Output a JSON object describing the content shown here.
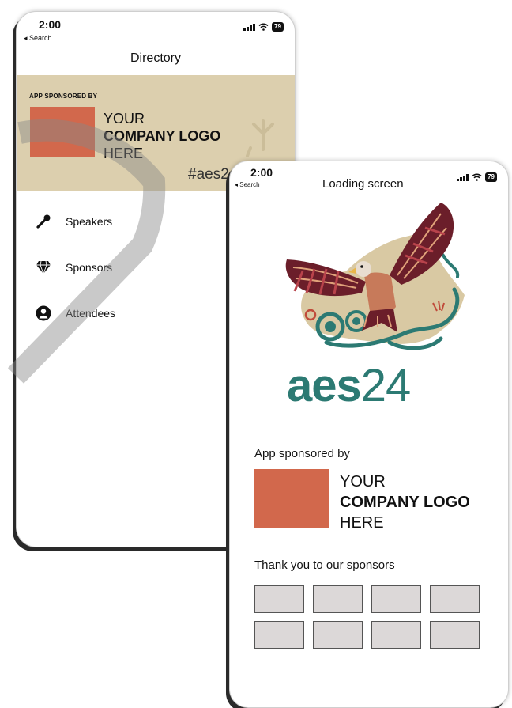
{
  "directory_screen": {
    "status": {
      "time": "2:00",
      "back": "◂ Search",
      "battery": "79"
    },
    "title": "Directory",
    "banner": {
      "sponsored_label": "APP SPONSORED BY",
      "logo_line1": "YOUR",
      "logo_line2": "COMPANY LOGO",
      "logo_line3": "HERE",
      "hashtag": "#aes2"
    },
    "menu": [
      {
        "label": "Speakers",
        "icon": "microphone-icon"
      },
      {
        "label": "Sponsors",
        "icon": "diamond-icon"
      },
      {
        "label": "Attendees",
        "icon": "person-icon"
      }
    ]
  },
  "loading_screen": {
    "status": {
      "time": "2:00",
      "back": "◂ Search",
      "battery": "79"
    },
    "title": "Loading screen",
    "brand_bold": "aes",
    "brand_light": "24",
    "sponsored_label": "App sponsored by",
    "logo_line1": "YOUR",
    "logo_line2": "COMPANY LOGO",
    "logo_line3": "HERE",
    "thanks_label": "Thank you to our sponsors"
  },
  "colors": {
    "banner_bg": "#dccfae",
    "logo_placeholder": "#d2684c",
    "brand_teal": "#2c7a73",
    "sponsor_placeholder": "#dcd8d8"
  }
}
